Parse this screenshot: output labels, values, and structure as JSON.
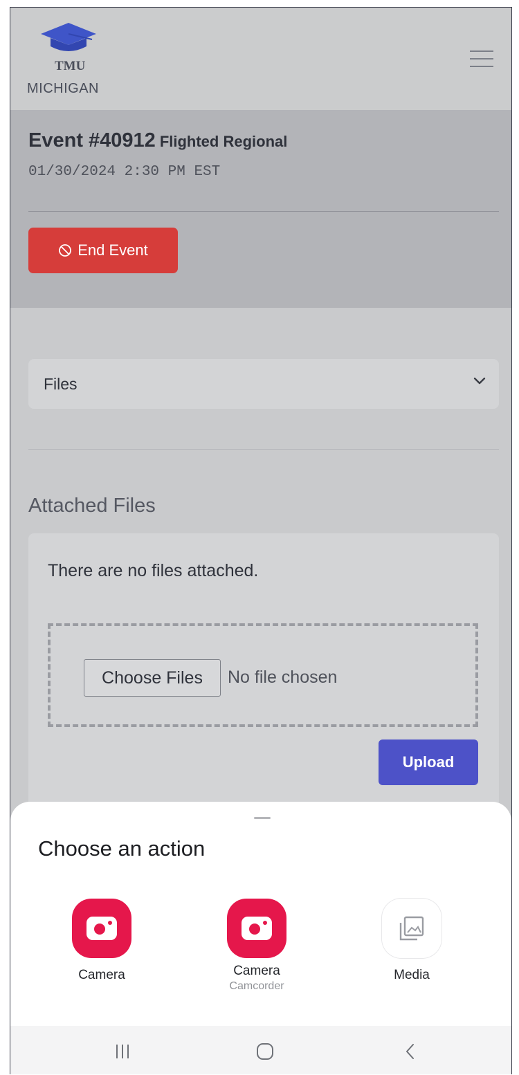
{
  "header": {
    "logo_text": "TMU",
    "logo_subtext": "MICHIGAN",
    "menu_icon": "hamburger-menu-icon"
  },
  "event": {
    "number": "Event #40912",
    "type": "Flighted Regional",
    "datetime": "01/30/2024 2:30 PM EST",
    "end_button_label": "End Event",
    "end_button_icon": "prohibited-icon",
    "accent_color": "#d63d3a"
  },
  "files_select": {
    "selected": "Files",
    "icon": "chevron-down-icon"
  },
  "attached_files": {
    "heading": "Attached Files",
    "empty_message": "There are no files attached.",
    "choose_button_label": "Choose Files",
    "file_status": "No file chosen",
    "upload_button_label": "Upload",
    "upload_color": "#4d52c8"
  },
  "action_sheet": {
    "title": "Choose an action",
    "apps": [
      {
        "label": "Camera",
        "sublabel": "",
        "icon": "camera-icon"
      },
      {
        "label": "Camera",
        "sublabel": "Camcorder",
        "icon": "camera-icon"
      },
      {
        "label": "Media",
        "sublabel": "",
        "icon": "gallery-icon"
      }
    ]
  },
  "system_nav": {
    "recents_icon": "recent-apps-icon",
    "home_icon": "home-icon",
    "back_icon": "back-icon"
  }
}
